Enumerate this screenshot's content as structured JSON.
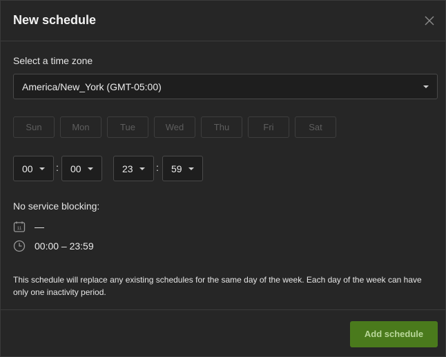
{
  "dialog": {
    "title": "New schedule",
    "close_icon": "close-icon"
  },
  "timezone": {
    "label": "Select a time zone",
    "value": "America/New_York (GMT-05:00)"
  },
  "days": [
    {
      "label": "Sun",
      "selected": false
    },
    {
      "label": "Mon",
      "selected": false
    },
    {
      "label": "Tue",
      "selected": false
    },
    {
      "label": "Wed",
      "selected": false
    },
    {
      "label": "Thu",
      "selected": false
    },
    {
      "label": "Fri",
      "selected": false
    },
    {
      "label": "Sat",
      "selected": false
    }
  ],
  "time": {
    "start_hour": "00",
    "start_minute": "00",
    "end_hour": "23",
    "end_minute": "59",
    "separator": ":"
  },
  "summary": {
    "label": "No service blocking:",
    "days_value": "—",
    "time_value": "00:00 – 23:59"
  },
  "note": "This schedule will replace any existing schedules for the same day of the week. Each day of the week can have only one inactivity period.",
  "footer": {
    "add_label": "Add schedule"
  },
  "colors": {
    "background": "#262626",
    "accent": "#4a7a1c",
    "accent_text": "#b9d79a"
  }
}
